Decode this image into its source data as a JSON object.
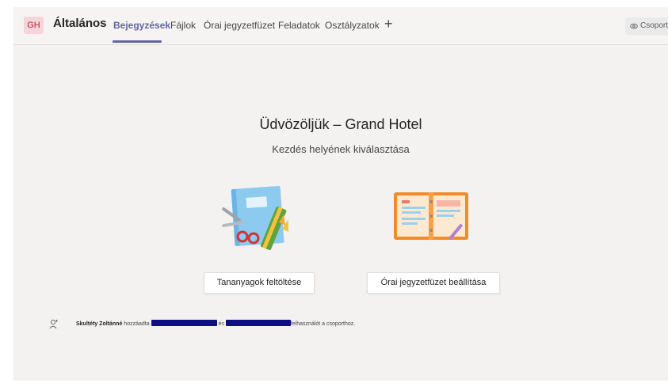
{
  "header": {
    "avatar_initials": "GH",
    "channel_name": "Általános",
    "tabs": [
      {
        "label": "Bejegyzések",
        "active": true
      },
      {
        "label": "Fájlok",
        "active": false
      },
      {
        "label": "Órai jegyzetfüzet",
        "active": false
      },
      {
        "label": "Feladatok",
        "active": false
      },
      {
        "label": "Osztályzatok",
        "active": false
      }
    ],
    "add_tab_symbol": "+",
    "team_button_label": "Csoport"
  },
  "main": {
    "welcome_title": "Üdvözöljük – Grand Hotel",
    "welcome_subtitle": "Kezdés helyének kiválasztása",
    "upload_button_label": "Tananyagok feltöltése",
    "notebook_button_label": "Órai jegyzetfüzet beállítása"
  },
  "activity": {
    "actor": "Skultéty Zoltánné",
    "text_part1": "hozzáadta",
    "text_part2": "és",
    "text_part3": "felhasználót a csoporthoz."
  },
  "colors": {
    "accent": "#6264a7",
    "avatar_bg": "#f6d4d8",
    "avatar_text": "#b4273d",
    "redaction": "#0d0d86"
  }
}
